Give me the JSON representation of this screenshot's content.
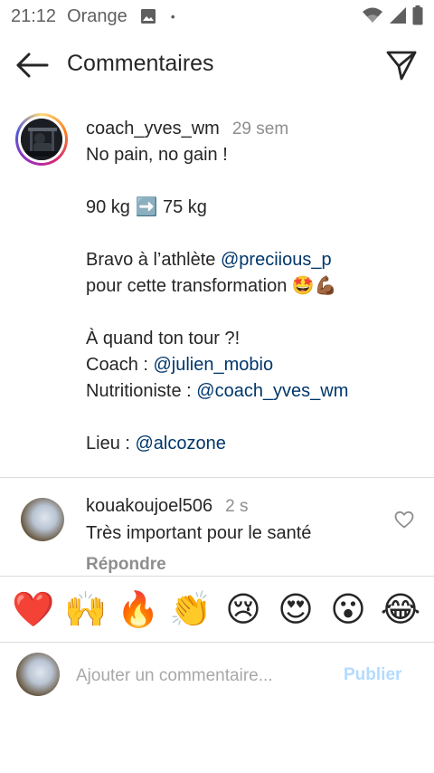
{
  "status_bar": {
    "time": "21:12",
    "carrier": "Orange",
    "dot": "•"
  },
  "header": {
    "title": "Commentaires"
  },
  "post": {
    "username": "coach_yves_wm",
    "time_ago": "29 sem",
    "line1": "No pain, no gain !",
    "line2_before": "90 kg ",
    "line2_emoji": "➡️",
    "line2_after": " 75 kg",
    "line3_before": "Bravo à l’athlète ",
    "line3_mention": "@preciious_p",
    "line4_text": "pour cette transformation ",
    "line4_emoji": "🤩💪🏾",
    "line5": "À quand ton tour ?!",
    "line6_label": "Coach : ",
    "line6_mention": "@julien_mobio",
    "line7_label": "Nutritioniste : ",
    "line7_mention": "@coach_yves_wm",
    "line8_label": "Lieu : ",
    "line8_mention": "@alcozone"
  },
  "comment": {
    "username": "kouakoujoel506",
    "time_ago": "2 s",
    "text": "Très important pour le santé",
    "reply_label": "Répondre"
  },
  "emoji_bar": [
    "❤️",
    "🙌",
    "🔥",
    "👏",
    "😢",
    "😍",
    "😮",
    "😂"
  ],
  "composer": {
    "placeholder": "Ajouter un commentaire...",
    "publish_label": "Publier"
  },
  "colors": {
    "mention": "#00376b",
    "publish_disabled": "#b3dbff",
    "secondary_text": "#8e8e8e"
  }
}
